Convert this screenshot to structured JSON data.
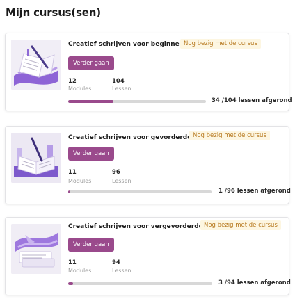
{
  "page": {
    "title": "Mijn cursus(sen)"
  },
  "colors": {
    "accent": "#9a4a8c",
    "badge_text": "#b7791f",
    "badge_bg": "#fdf6e1",
    "track": "#d8d8d8"
  },
  "labels": {
    "continue": "Verder gaan",
    "modules": "Modules",
    "lessons": "Lessen"
  },
  "courses": [
    {
      "title": "Creatief schrijven voor beginners",
      "status": "Nog bezig met de cursus",
      "modules": "12",
      "lessons": "104",
      "completed": 34,
      "total": 104,
      "progress_label": "34 /104 lessen afgerond"
    },
    {
      "title": "Creatief schrijven voor gevorderden",
      "status": "Nog bezig met de cursus",
      "modules": "11",
      "lessons": "96",
      "completed": 1,
      "total": 96,
      "progress_label": "1 /96 lessen afgerond"
    },
    {
      "title": "Creatief schrijven voor vergevorderden",
      "status": "Nog bezig met de cursus",
      "modules": "11",
      "lessons": "94",
      "completed": 3,
      "total": 94,
      "progress_label": "3 /94 lessen afgerond"
    }
  ]
}
